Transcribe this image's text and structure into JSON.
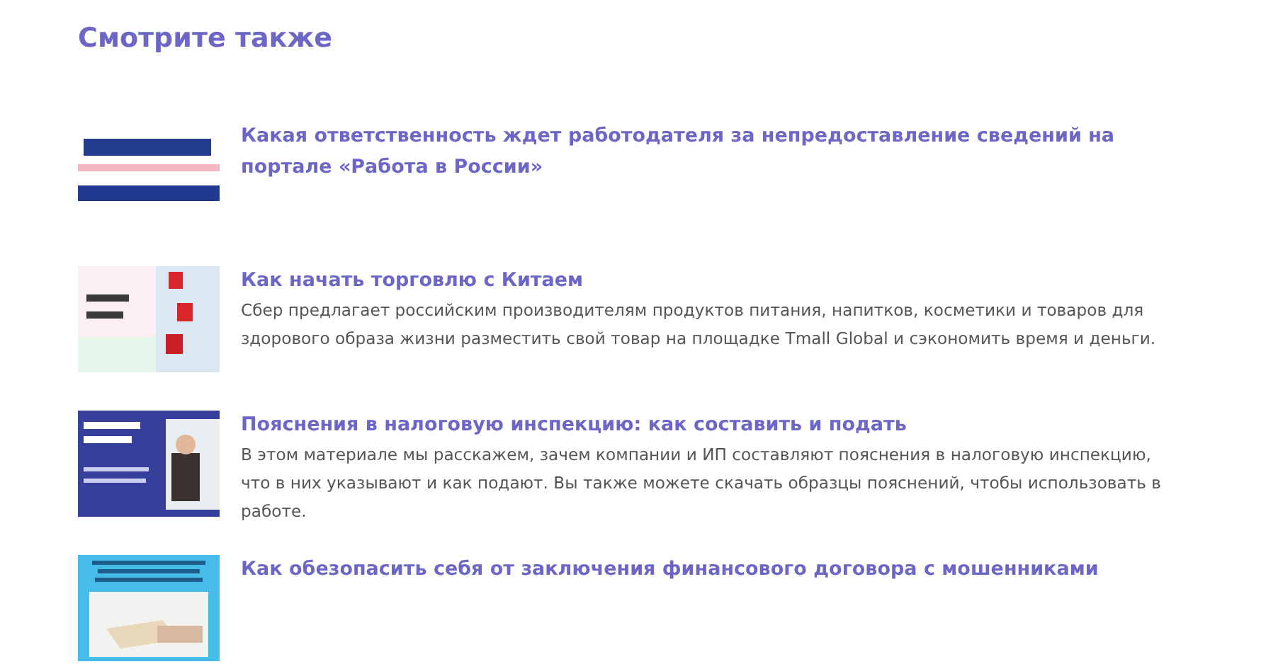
{
  "heading": "Смотрите также",
  "articles": [
    {
      "title": "Какая ответственность ждет работодателя за непредоставление сведений на портале «Работа в России»"
    },
    {
      "title": "Как начать торговлю с Китаем",
      "summary": "Сбер предлагает российским производителям продуктов питания, напитков, косметики и товаров для здорового образа жизни разместить свой товар на площадке Tmall Global и сэкономить время и деньги."
    },
    {
      "title": "Пояснения в налоговую инспекцию: как составить и подать",
      "summary": "В этом материале мы расскажем, зачем компании и ИП составляют пояснения в налоговую инспекцию, что в них указывают и как подают. Вы также можете скачать образцы пояснений, чтобы использовать в работе."
    },
    {
      "title": "Как обезопасить себя от заключения финансового договора с мошенниками"
    }
  ]
}
